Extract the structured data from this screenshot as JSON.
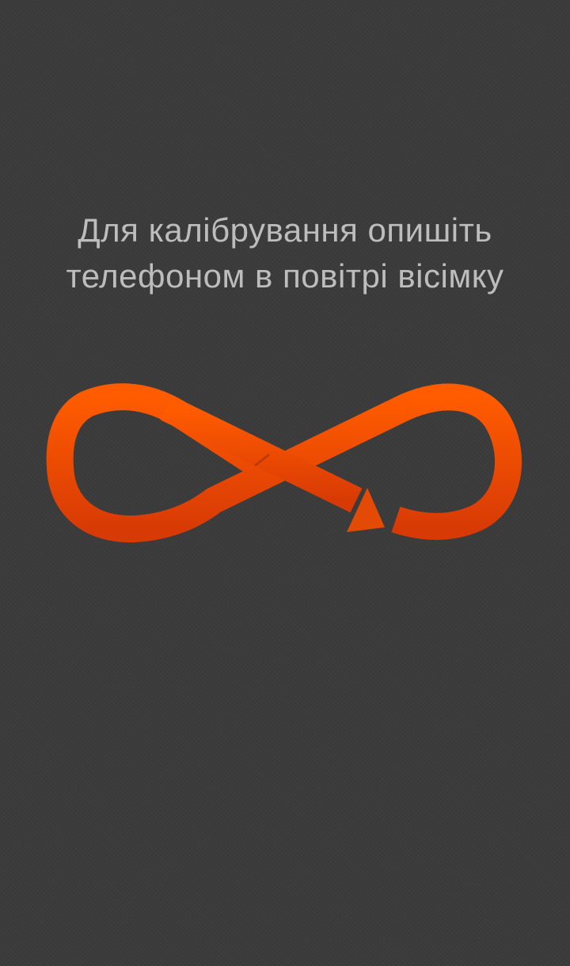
{
  "instruction": {
    "line1": "Для калібрування опишіть",
    "line2": "телефоном в повітрі вісімку"
  },
  "figure": {
    "icon": "figure-eight-arrow-icon",
    "accent_top": "#ff5c00",
    "accent_bottom": "#d83a05"
  }
}
